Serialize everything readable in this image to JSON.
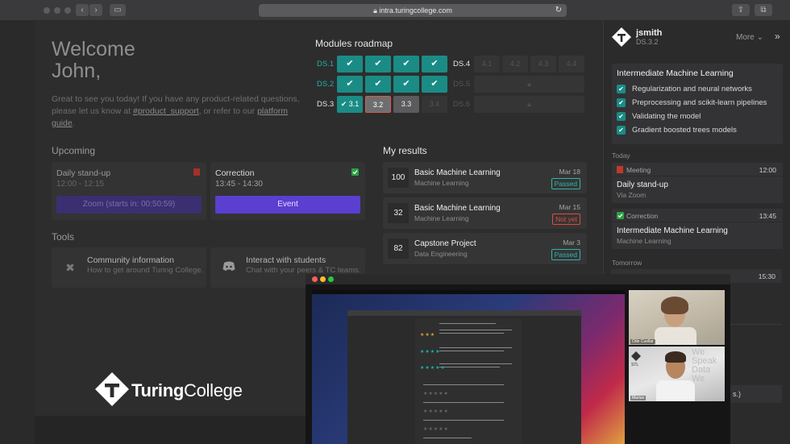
{
  "browser": {
    "url": "intra.turingcollege.com"
  },
  "welcome": {
    "title_line1": "Welcome",
    "title_line2": "John,",
    "intro_pre": "Great to see you today! If you have any product-related questions, please let us know at ",
    "intro_link1": "#product_support",
    "intro_mid": ", or refer to our ",
    "intro_link2": "platform guide",
    "intro_post": "."
  },
  "upcoming": {
    "title": "Upcoming",
    "cards": [
      {
        "title": "Daily stand-up",
        "time": "12:00 - 12:15",
        "button": "Zoom (starts in: 00:50:59)"
      },
      {
        "title": "Correction",
        "time": "13:45 - 14:30",
        "button": "Event"
      }
    ]
  },
  "tools": {
    "title": "Tools",
    "cards": [
      {
        "title": "Community information",
        "desc": "How to get around Turing College."
      },
      {
        "title": "Interact with students",
        "desc": "Chat with your peers & TC teams."
      }
    ]
  },
  "roadmap": {
    "title": "Modules roadmap",
    "rows": [
      {
        "label_a": "DS.1",
        "label_b": "DS.4",
        "b_cells": [
          "4.1",
          "4.2",
          "4.3",
          "4.4"
        ]
      },
      {
        "label_a": "DS.2",
        "label_b": "DS.5"
      },
      {
        "label_a": "DS.3",
        "label_b": "DS.6",
        "a_cells": [
          "3.1",
          "3.2",
          "3.3",
          "3.4"
        ]
      }
    ]
  },
  "results": {
    "title": "My results",
    "items": [
      {
        "score": "100",
        "name": "Basic Machine Learning",
        "sub": "Machine Learning",
        "date": "Mar 18",
        "status": "Passed"
      },
      {
        "score": "32",
        "name": "Basic Machine Learning",
        "sub": "Machine Learning",
        "date": "Mar 15",
        "status": "Not yet"
      },
      {
        "score": "82",
        "name": "Capstone Project",
        "sub": "Data Engineering",
        "date": "Mar 3",
        "status": "Passed"
      }
    ]
  },
  "sidebar": {
    "user": "jsmith",
    "program": "DS.3.2",
    "more": "More",
    "sprint_title": "Intermediate Machine Learning",
    "checklist": [
      "Regularization and neural networks",
      "Preprocessing and scikit-learn pipelines",
      "Validating the model",
      "Gradient boosted trees models"
    ],
    "today_label": "Today",
    "events": [
      {
        "kind": "Meeting",
        "time": "12:00",
        "name": "Daily stand-up",
        "sub": "Via Zoom"
      },
      {
        "kind": "Correction",
        "time": "13:45",
        "name": "Intermediate Machine Learning",
        "sub": "Machine Learning"
      }
    ],
    "tomorrow_label": "Tomorrow",
    "tomorrow_time": "15:30",
    "partial_text": "s.)"
  },
  "video": {
    "cam1_label": "Ode Cuellar",
    "cam2_label": "Marius",
    "bg_text": "We Speak Data We"
  },
  "brand": {
    "name_bold": "Turing",
    "name_regular": "College"
  },
  "colors": {
    "accent_teal": "#1a8c85",
    "event_purple": "#5b3fd0",
    "fail_red": "#e04a3c"
  }
}
